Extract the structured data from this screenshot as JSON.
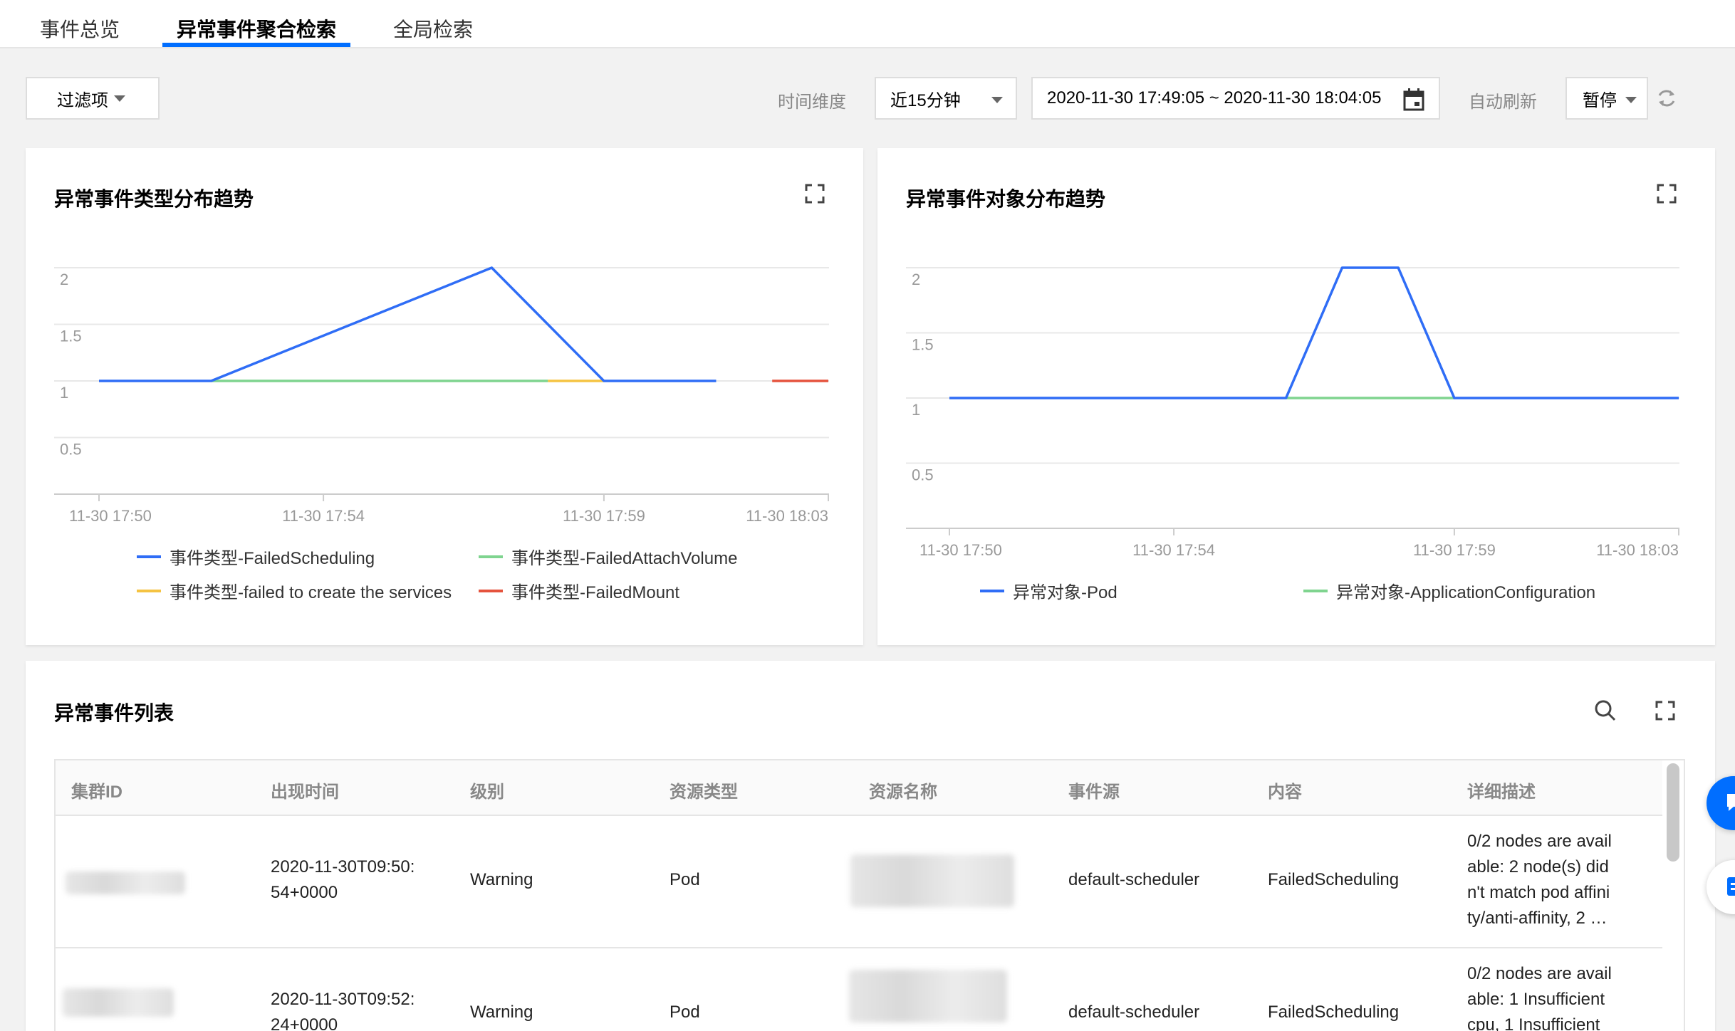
{
  "tabs": [
    {
      "label": "事件总览"
    },
    {
      "label": "异常事件聚合检索"
    },
    {
      "label": "全局检索"
    }
  ],
  "toolbar": {
    "filter_label": "过滤项",
    "time_dimension_label": "时间维度",
    "time_range_select": "近15分钟",
    "time_range_value": "2020-11-30 17:49:05 ~ 2020-11-30 18:04:05",
    "auto_refresh_label": "自动刷新",
    "auto_refresh_select": "暂停"
  },
  "colors": {
    "accent": "#006eff",
    "series_blue": "#2f6df6",
    "series_green": "#7fd48f",
    "series_yellow": "#f5c342",
    "series_red": "#e5533d"
  },
  "chart_type": {
    "title": "异常事件类型分布趋势",
    "chart_data": {
      "type": "line",
      "ylim": [
        0,
        2
      ],
      "y_ticks": [
        "2",
        "1.5",
        "1",
        "0.5"
      ],
      "x_ticks": [
        "11-30 17:50",
        "11-30 17:54",
        "11-30 17:59",
        "11-30 18:03"
      ],
      "series": [
        {
          "name": "事件类型-FailedScheduling",
          "color": "#2f6df6",
          "x": [
            "17:50",
            "17:52",
            "17:57",
            "17:59",
            "18:01"
          ],
          "y": [
            1,
            1,
            2,
            1,
            1
          ]
        },
        {
          "name": "事件类型-FailedAttachVolume",
          "color": "#7fd48f",
          "x": [
            "17:52",
            "17:58"
          ],
          "y": [
            1,
            1
          ]
        },
        {
          "name": "事件类型-failed to create the services",
          "color": "#f5c342",
          "x": [
            "17:58",
            "17:59"
          ],
          "y": [
            1,
            1
          ]
        },
        {
          "name": "事件类型-FailedMount",
          "color": "#e5533d",
          "x": [
            "18:02",
            "18:03"
          ],
          "y": [
            1,
            1
          ]
        }
      ]
    }
  },
  "chart_object": {
    "title": "异常事件对象分布趋势",
    "chart_data": {
      "type": "line",
      "ylim": [
        0,
        2
      ],
      "y_ticks": [
        "2",
        "1.5",
        "1",
        "0.5"
      ],
      "x_ticks": [
        "11-30 17:50",
        "11-30 17:54",
        "11-30 17:59",
        "11-30 18:03"
      ],
      "series": [
        {
          "name": "异常对象-Pod",
          "color": "#2f6df6",
          "x": [
            "17:50",
            "17:56",
            "17:57",
            "17:58",
            "17:59",
            "18:03"
          ],
          "y": [
            1,
            1,
            2,
            2,
            1,
            1
          ]
        },
        {
          "name": "异常对象-ApplicationConfiguration",
          "color": "#7fd48f",
          "x": [
            "17:56",
            "17:59"
          ],
          "y": [
            1,
            1
          ]
        }
      ]
    }
  },
  "event_list": {
    "title": "异常事件列表",
    "columns": [
      "集群ID",
      "出现时间",
      "级别",
      "资源类型",
      "资源名称",
      "事件源",
      "内容",
      "详细描述"
    ],
    "rows": [
      {
        "time_line1": "2020-11-30T09:50:",
        "time_line2": "54+0000",
        "level": "Warning",
        "resource_type": "Pod",
        "source": "default-scheduler",
        "content": "FailedScheduling",
        "detail": [
          "0/2 nodes are avail",
          "able: 2 node(s) did",
          "n't match pod affini",
          "ty/anti-affinity, 2 …"
        ]
      },
      {
        "time_line1": "2020-11-30T09:52:",
        "time_line2": "24+0000",
        "level": "Warning",
        "resource_type": "Pod",
        "source": "default-scheduler",
        "content": "FailedScheduling",
        "detail": [
          "0/2 nodes are avail",
          "able: 1 Insufficient",
          "cpu, 1 Insufficient"
        ]
      }
    ]
  }
}
